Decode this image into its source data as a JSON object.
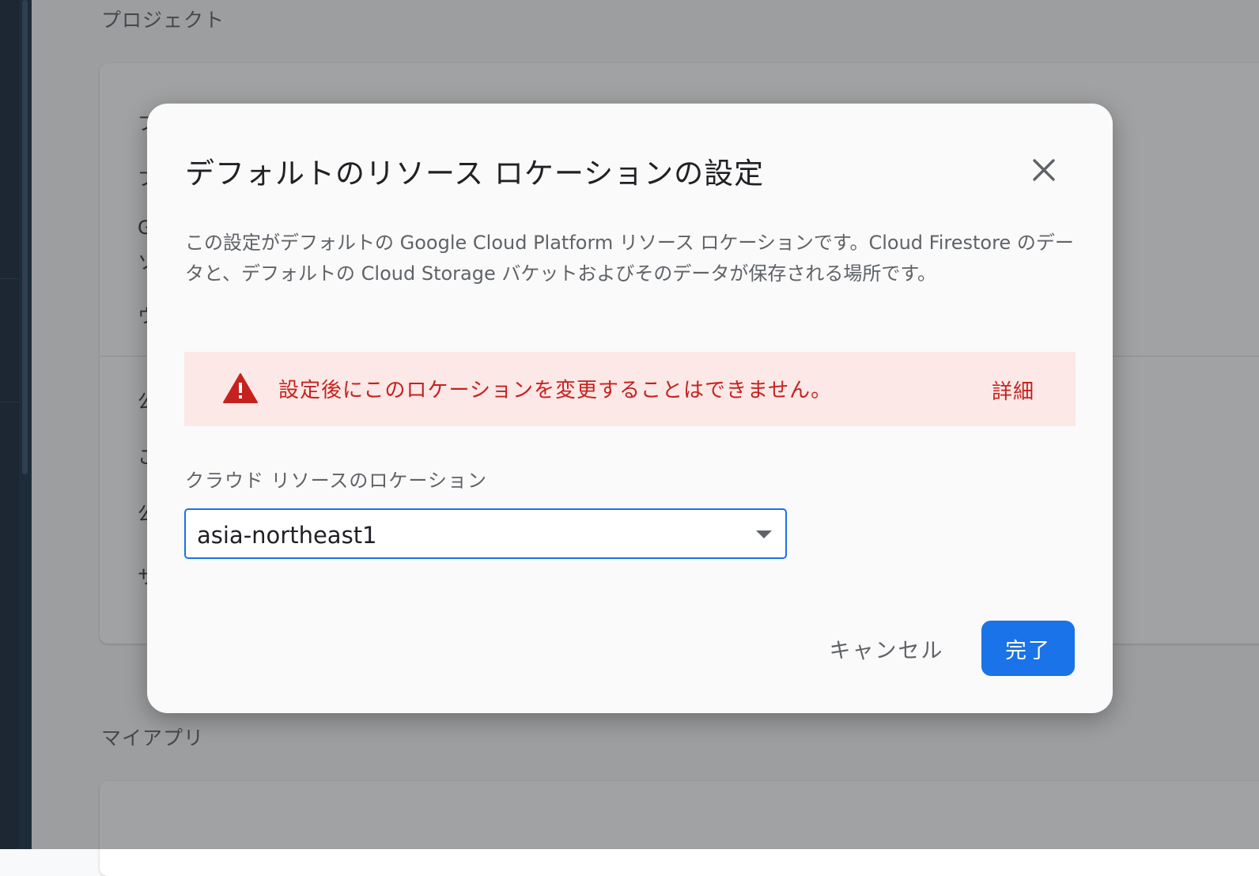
{
  "background": {
    "project_section_title": "プロジェクト",
    "myapps_section_title": "マイアプリ",
    "card_snippets": [
      "プ",
      "プ",
      "G",
      "ソ",
      "ウ",
      "公",
      "こ",
      "公",
      "サ"
    ]
  },
  "dialog": {
    "title": "デフォルトのリソース ロケーションの設定",
    "description": "この設定がデフォルトの Google Cloud Platform リソース ロケーションです。Cloud Firestore のデータと、デフォルトの Cloud Storage バケットおよびそのデータが保存される場所です。",
    "warning": {
      "text": "設定後にこのロケーションを変更することはできません。",
      "link_label": "詳細",
      "color": "#c5221f",
      "background": "#fce8e6"
    },
    "location_field": {
      "label": "クラウド リソースのロケーション",
      "selected_value": "asia-northeast1"
    },
    "actions": {
      "cancel_label": "キャンセル",
      "done_label": "完了"
    },
    "accent_color": "#1a73e8"
  }
}
